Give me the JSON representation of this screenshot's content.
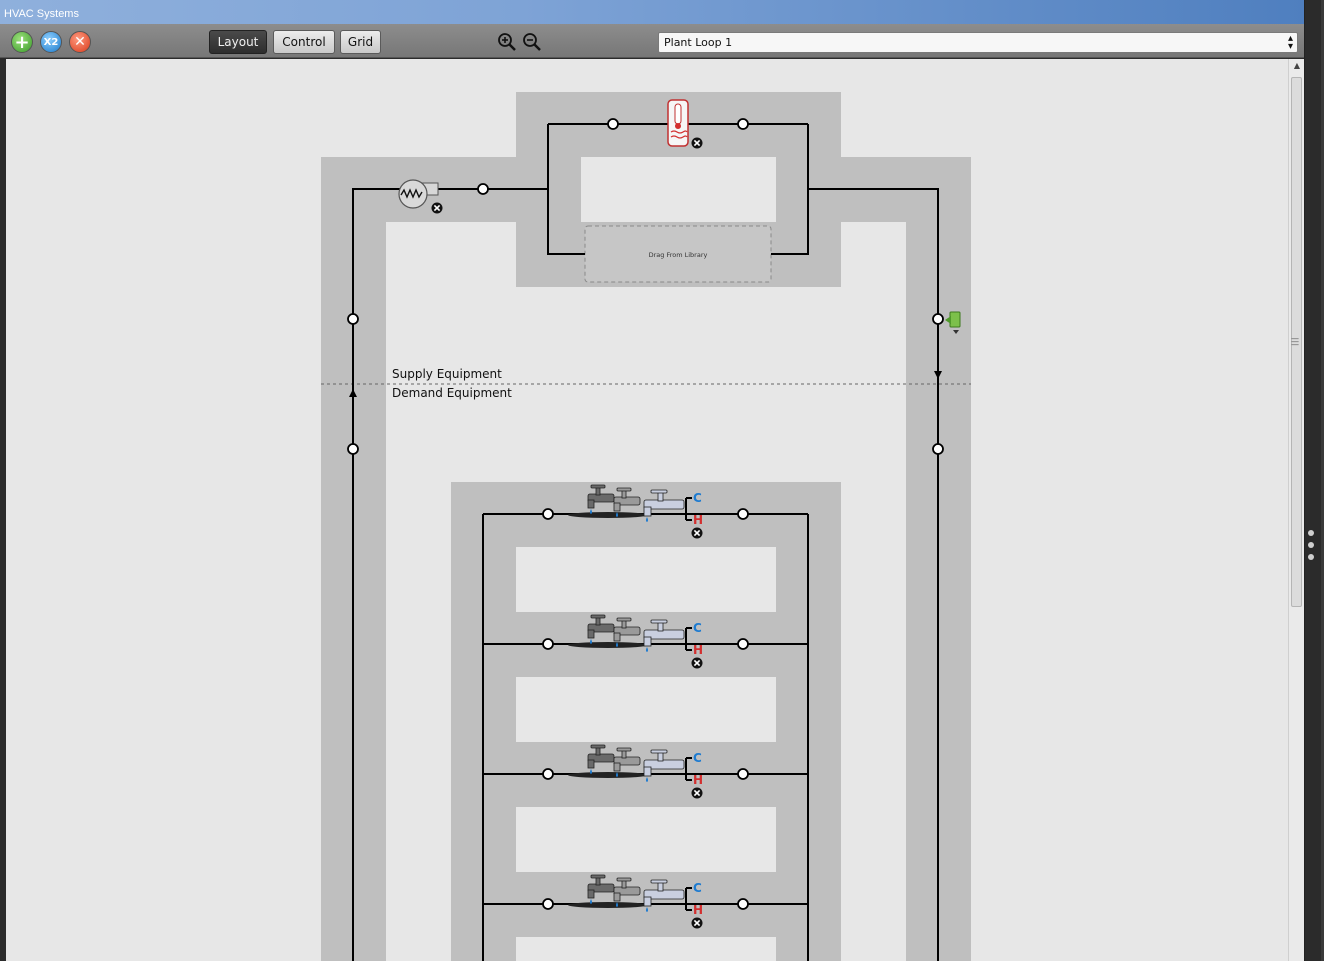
{
  "window": {
    "title": "HVAC Systems"
  },
  "toolbar": {
    "add_button_icon": "plus-icon",
    "duplicate_button_icon": "x2-icon",
    "delete_button_icon": "close-icon",
    "tabs": [
      {
        "label": "Layout",
        "active": true
      },
      {
        "label": "Control",
        "active": false
      },
      {
        "label": "Grid",
        "active": false
      }
    ],
    "zoom_in_icon": "zoom-in-icon",
    "zoom_out_icon": "zoom-out-icon",
    "loop_select": {
      "value": "Plant Loop 1"
    }
  },
  "diagram": {
    "drop_zone_label": "Drag From Library",
    "supply_label": "Supply Equipment",
    "demand_label": "Demand Equipment",
    "supply_components": [
      "water-heater-icon",
      "pump-icon"
    ],
    "demand_components": [
      "water-use-connections-icon",
      "water-use-connections-icon",
      "water-use-connections-icon",
      "water-use-connections-icon"
    ],
    "setpoint_manager_icon": "setpoint-manager-icon",
    "hot_label": "H",
    "cold_label": "C",
    "colors": {
      "panel": "#bfbfbf",
      "background": "#e7e7e7",
      "hot": "#d32f2f",
      "cold": "#1e7bd0"
    }
  }
}
